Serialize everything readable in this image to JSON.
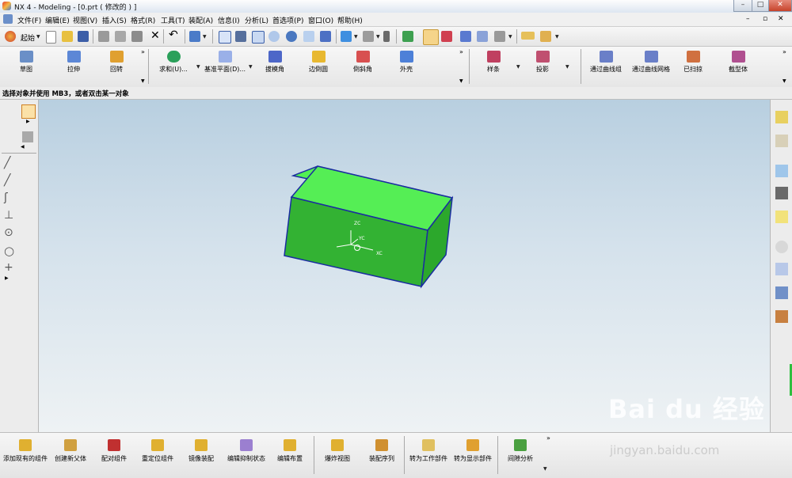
{
  "window": {
    "title": "NX 4 - Modeling - [0.prt  ( 修改的 ) ]",
    "min": "–",
    "max": "□",
    "close": "✕"
  },
  "menu": [
    "文件(F)",
    "编辑(E)",
    "视图(V)",
    "插入(S)",
    "格式(R)",
    "工具(T)",
    "装配(A)",
    "信息(I)",
    "分析(L)",
    "首选项(P)",
    "窗口(O)",
    "帮助(H)"
  ],
  "toolbar_main": {
    "start_label": "起始"
  },
  "feature_toolbar": [
    {
      "label": "草图",
      "color": "#6a8fc7"
    },
    {
      "label": "拉伸",
      "color": "#5c87d6"
    },
    {
      "label": "回转",
      "color": "#e0a030"
    },
    {
      "label": "求和(U)...",
      "color": "#2aa05a"
    },
    {
      "label": "基准平面(D)...",
      "color": "#9ab0e8"
    },
    {
      "label": "拔模角",
      "color": "#4d67c8"
    },
    {
      "label": "边倒圆",
      "color": "#e8b830"
    },
    {
      "label": "倒斜角",
      "color": "#d85050"
    },
    {
      "label": "外壳",
      "color": "#4d80d8"
    },
    {
      "label": "样条",
      "color": "#c04060"
    },
    {
      "label": "投影",
      "color": "#c05070"
    },
    {
      "label": "通过曲线组",
      "color": "#6a7fc8"
    },
    {
      "label": "通过曲线网格",
      "color": "#6a7fc8"
    },
    {
      "label": "已扫掠",
      "color": "#d07040"
    },
    {
      "label": "截型体",
      "color": "#b05090"
    }
  ],
  "hint": "选择对象并使用 MB3，或者双击某一对象",
  "axes": {
    "z": "ZC",
    "y": "YC",
    "x": "XC"
  },
  "assembly_toolbar": [
    {
      "label": "添加现有的组件",
      "color": "#e0b030"
    },
    {
      "label": "创建新父体",
      "color": "#d0a040"
    },
    {
      "label": "配对组件",
      "color": "#c03030"
    },
    {
      "label": "重定位组件",
      "color": "#e0b030"
    },
    {
      "label": "镜像装配",
      "color": "#e0b030"
    },
    {
      "label": "编辑抑制状态",
      "color": "#9b7fd0"
    },
    {
      "label": "编辑布置",
      "color": "#e0b030"
    },
    {
      "label": "爆炸视图",
      "color": "#e0b030"
    },
    {
      "label": "装配序列",
      "color": "#d09030"
    },
    {
      "label": "转为工作部件",
      "color": "#e0c060"
    },
    {
      "label": "转为显示部件",
      "color": "#e0a030"
    },
    {
      "label": "间隙分析",
      "color": "#4aa040"
    }
  ],
  "watermark": {
    "brand": "Bai du 经验",
    "url": "jingyan.baidu.com"
  },
  "colors": {
    "solid_front": "#33b233",
    "solid_top": "#52f052",
    "solid_side": "#2ca82c",
    "edge": "#1a2da0"
  }
}
